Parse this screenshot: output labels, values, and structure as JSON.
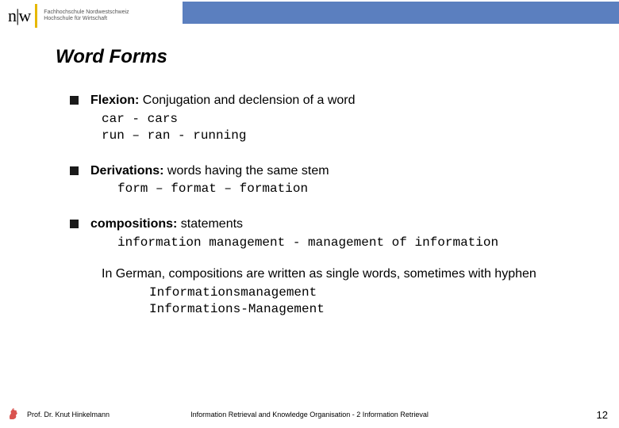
{
  "header": {
    "logo_initials": "n|w",
    "logo_line1": "Fachhochschule Nordwestschweiz",
    "logo_line2": "Hochschule für Wirtschaft"
  },
  "title": "Word Forms",
  "bullets": [
    {
      "label": "Flexion:",
      "desc": " Conjugation and declension of a word",
      "code": "car - cars\nrun – ran - running"
    },
    {
      "label": "Derivations:",
      "desc": " words having the same stem",
      "code": "form – format – formation"
    },
    {
      "label": "compositions:",
      "desc": " statements",
      "code": "information management - management of information",
      "sub_text": "In German, compositions are written as single words, sometimes with hyphen",
      "sub_code": "Informationsmanagement\nInformations-Management"
    }
  ],
  "footer": {
    "author": "Prof. Dr. Knut Hinkelmann",
    "course": "Information Retrieval and Knowledge Organisation - 2 Information Retrieval",
    "page": "12"
  }
}
